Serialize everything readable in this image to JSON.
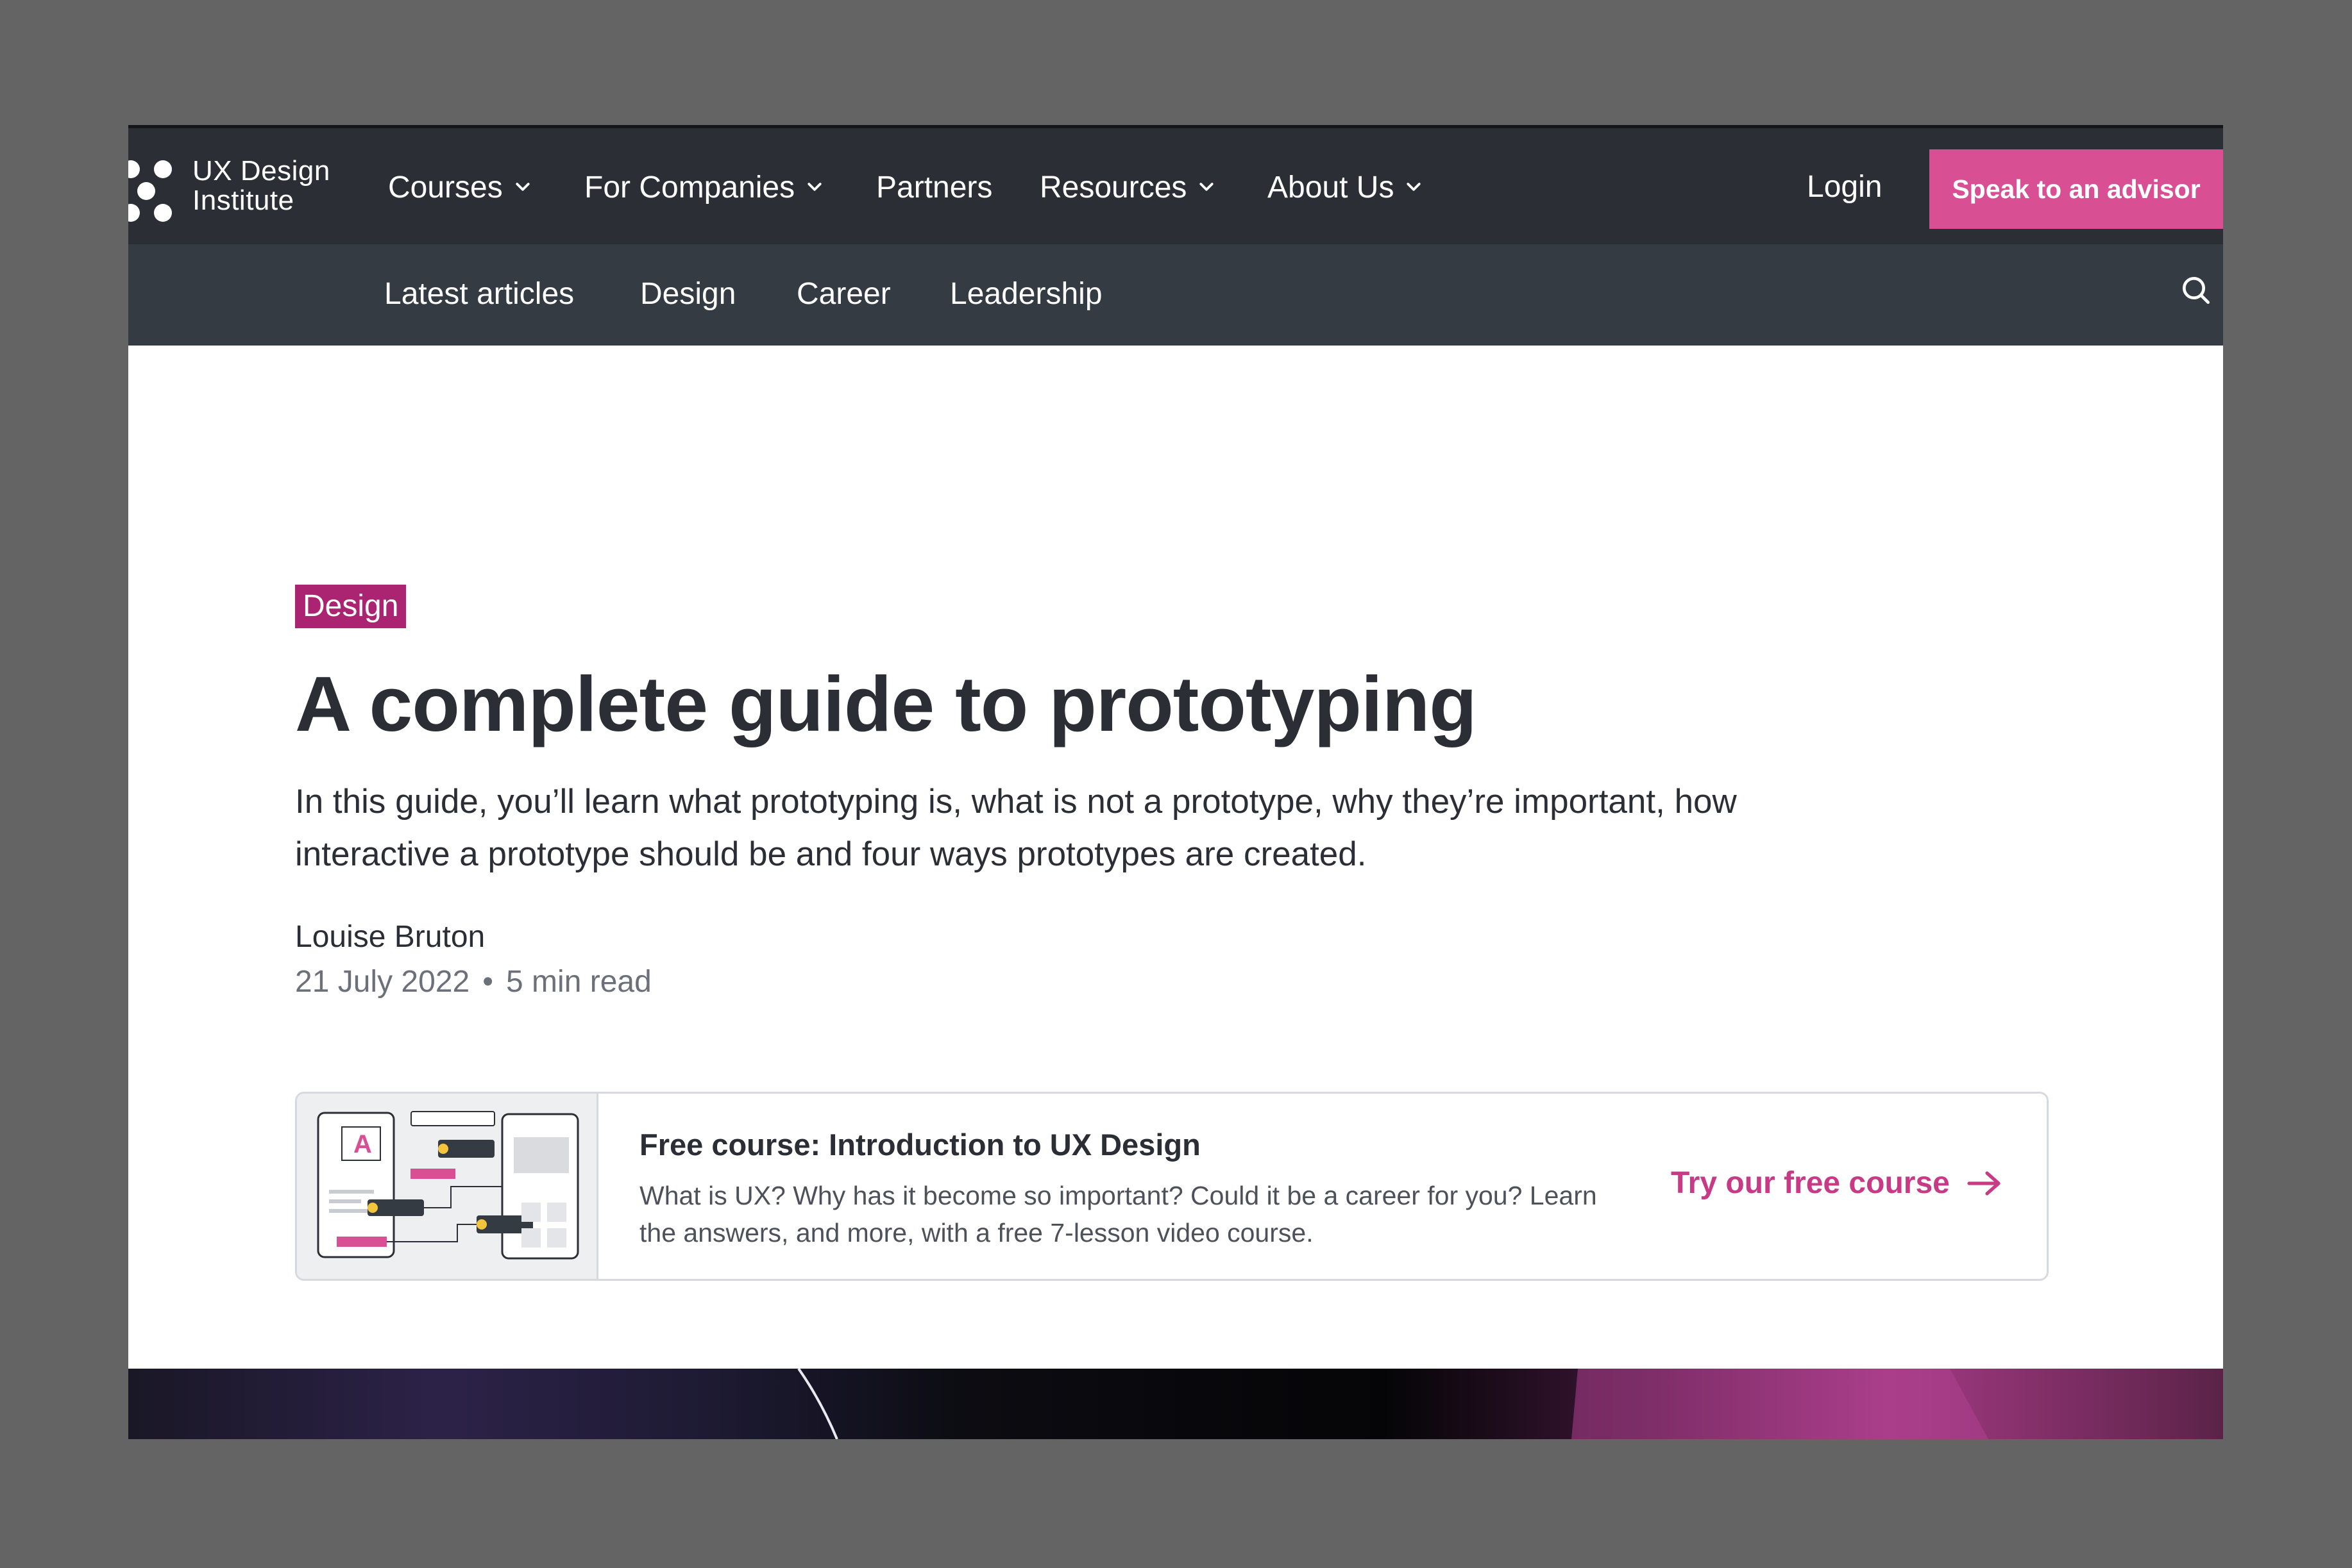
{
  "brand": {
    "logo_line1": "UX Design",
    "logo_line2": "Institute"
  },
  "topnav": {
    "items": [
      {
        "label": "Courses",
        "has_dropdown": true
      },
      {
        "label": "For Companies",
        "has_dropdown": true
      },
      {
        "label": "Partners",
        "has_dropdown": false
      },
      {
        "label": "Resources",
        "has_dropdown": true
      },
      {
        "label": "About Us",
        "has_dropdown": true
      }
    ],
    "login_label": "Login",
    "advisor_label": "Speak to an advisor"
  },
  "subnav": {
    "items": [
      "Latest articles",
      "Design",
      "Career",
      "Leadership"
    ],
    "search_icon": "search-icon"
  },
  "article": {
    "category": "Design",
    "title": "A complete guide to prototyping",
    "intro": "In this guide, you’ll learn what prototyping is, what is not a prototype, why they’re important, how interactive a prototype should be and four ways prototypes are created.",
    "author": "Louise Bruton",
    "date": "21 July 2022",
    "separator": "•",
    "read_time": "5 min read"
  },
  "course_card": {
    "title": "Free course: Introduction to UX Design",
    "description": "What is UX? Why has it become so important? Could it be a career for you? Learn the answers, and more, with a free 7-lesson video course.",
    "cta_label": "Try our free course",
    "cta_icon": "arrow-right-icon"
  },
  "colors": {
    "nav_bg": "#2b2f35",
    "subnav_bg": "#353b43",
    "accent_pink": "#d84f93",
    "category_tag_bg": "#aa2472",
    "cta_text": "#c73a85"
  }
}
